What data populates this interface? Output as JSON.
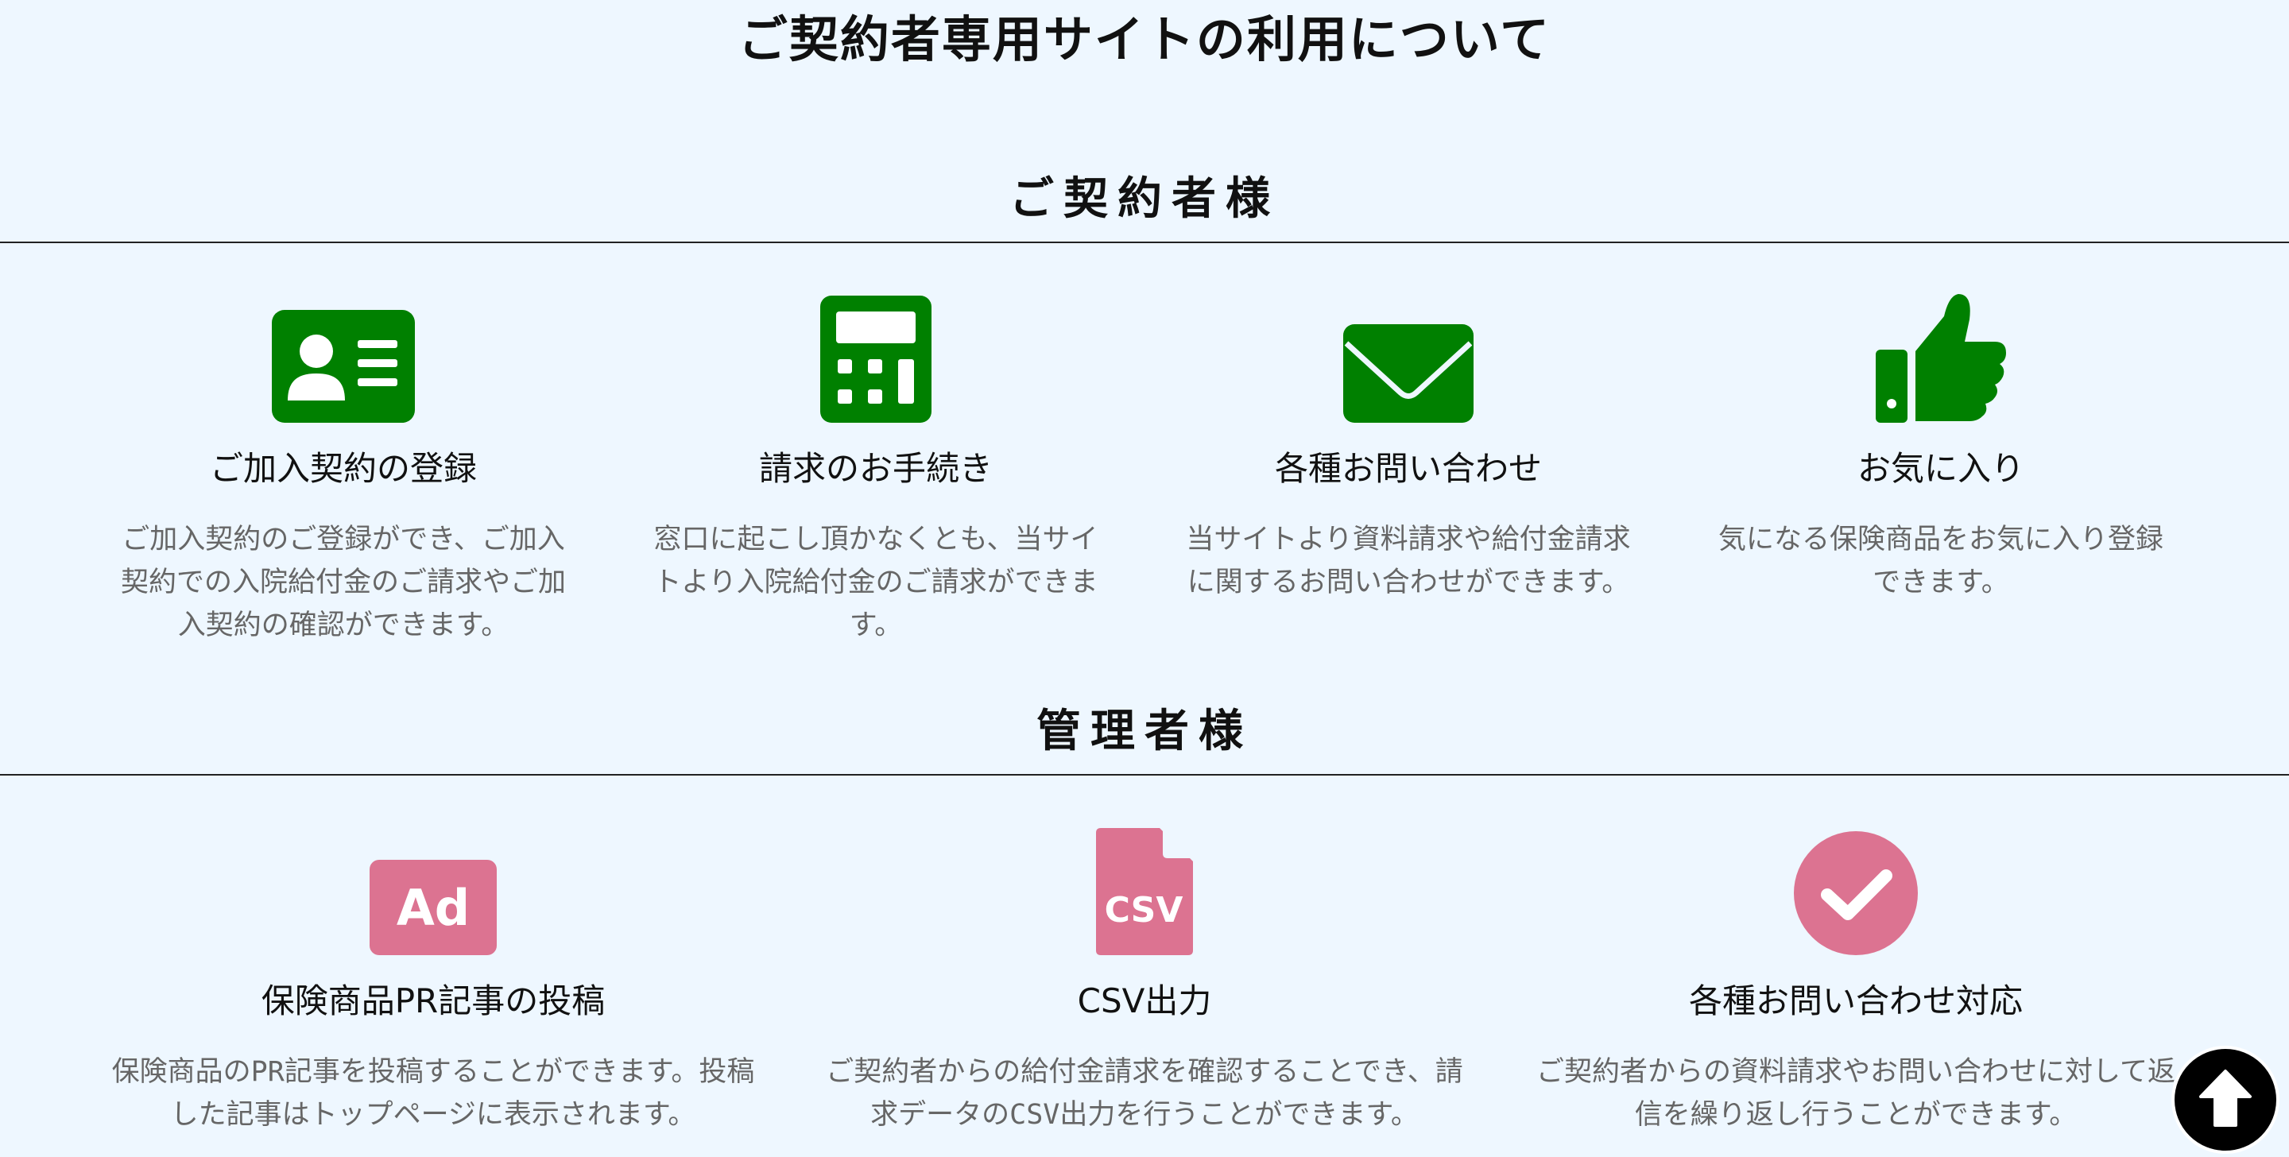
{
  "page": {
    "title": "ご契約者専用サイトの利用について"
  },
  "colors": {
    "background": "#eef7ff",
    "contractor_icon": "#008000",
    "admin_icon": "#dc7391",
    "title_text": "#111111",
    "description_text": "#666666"
  },
  "sections": {
    "contractor": {
      "heading": "ご契約者様",
      "features": [
        {
          "icon": "id-card-icon",
          "title": "ご加入契約の登録",
          "description": "ご加入契約のご登録ができ、ご加入契約での入院給付金のご請求やご加入契約の確認ができます。"
        },
        {
          "icon": "calculator-icon",
          "title": "請求のお手続き",
          "description": "窓口に起こし頂かなくとも、当サイトより入院給付金のご請求ができます。"
        },
        {
          "icon": "envelope-icon",
          "title": "各種お問い合わせ",
          "description": "当サイトより資料請求や給付金請求に関するお問い合わせができます。"
        },
        {
          "icon": "thumbs-up-icon",
          "title": "お気に入り",
          "description": "気になる保険商品をお気に入り登録できます。"
        }
      ]
    },
    "admin": {
      "heading": "管理者様",
      "features": [
        {
          "icon": "ad-icon",
          "icon_text": "Ad",
          "title": "保険商品PR記事の投稿",
          "description": "保険商品のPR記事を投稿することができます。投稿した記事はトップページに表示されます。"
        },
        {
          "icon": "csv-file-icon",
          "icon_text": "CSV",
          "title": "CSV出力",
          "description": "ご契約者からの給付金請求を確認することでき、請求データのCSV出力を行うことができます。"
        },
        {
          "icon": "check-circle-icon",
          "title": "各種お問い合わせ対応",
          "description": "ご契約者からの資料請求やお問い合わせに対して返信を繰り返し行うことができます。"
        }
      ]
    }
  },
  "scroll_top": {
    "icon": "arrow-up-icon"
  }
}
